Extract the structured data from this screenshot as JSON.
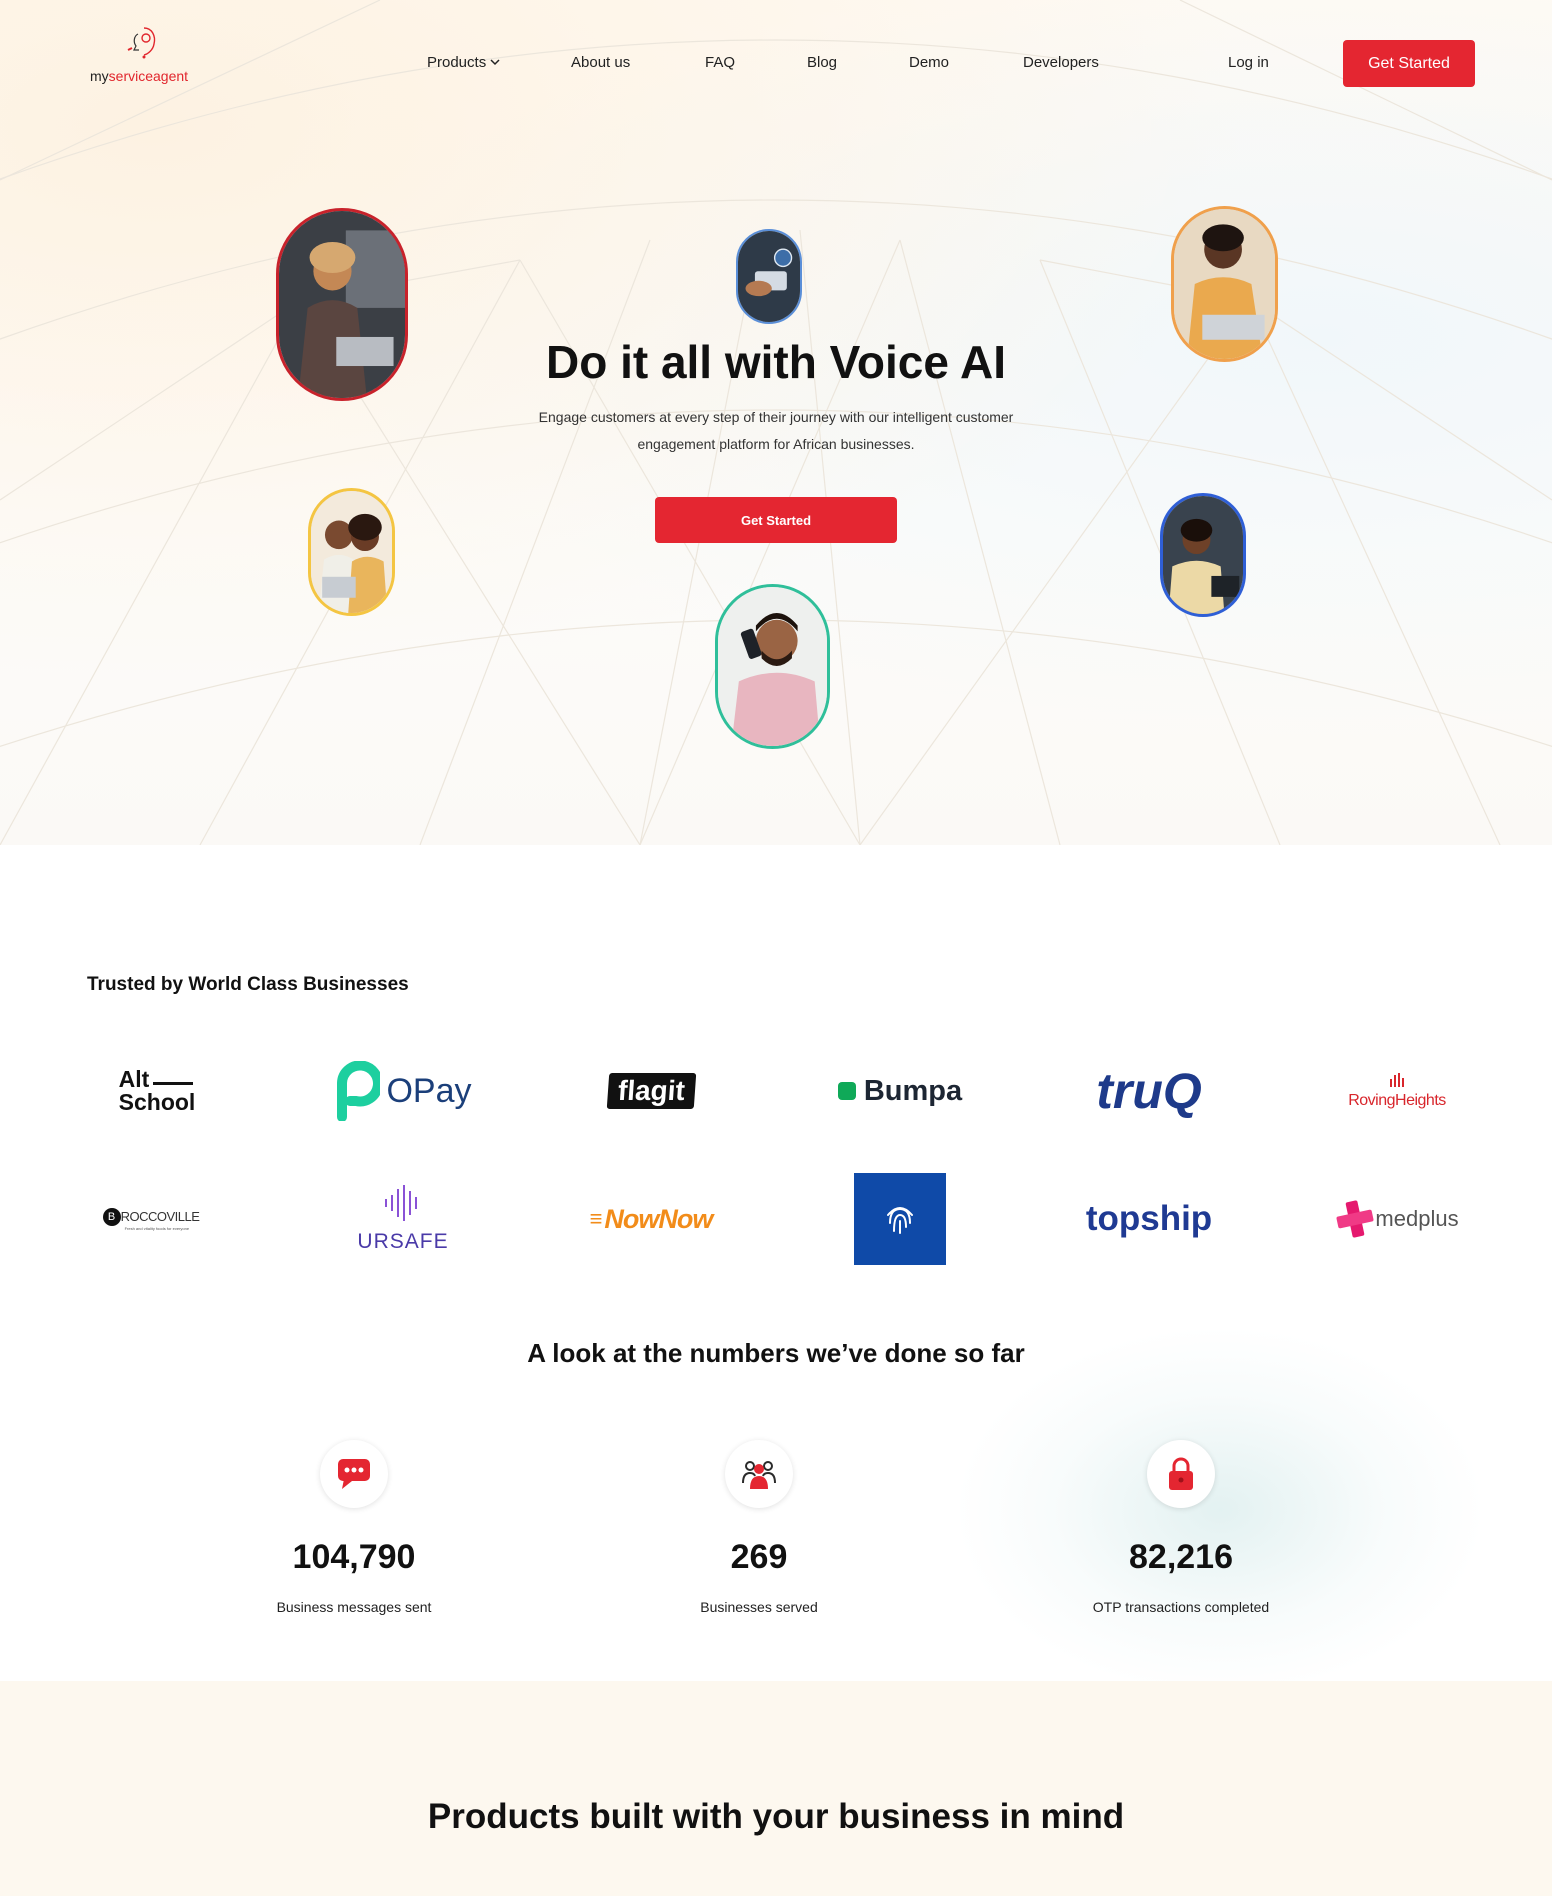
{
  "colors": {
    "brand_red": "#e42631",
    "hero_bg": "#fffaf3",
    "products_bg": "#fdf8ef"
  },
  "header": {
    "logo": {
      "prefix": "my",
      "suffix": "serviceagent",
      "icon": "headset-face-icon"
    },
    "nav": [
      {
        "label": "Products",
        "icon": "chevron-down-icon"
      },
      {
        "label": "About us"
      },
      {
        "label": "FAQ"
      },
      {
        "label": "Blog"
      },
      {
        "label": "Demo"
      },
      {
        "label": "Developers"
      },
      {
        "label": "Log in"
      }
    ],
    "cta_label": "Get Started"
  },
  "hero": {
    "title": "Do it all with Voice AI",
    "subtitle_line1": "Engage customers at every step of their journey with our intelligent customer",
    "subtitle_line2": "engagement platform for African businesses.",
    "cta_label": "Get Started",
    "avatars": [
      "red",
      "blue",
      "orange",
      "yellow",
      "green",
      "navy"
    ]
  },
  "trusted": {
    "heading": "Trusted by World Class Businesses",
    "logos": [
      {
        "name": "AltSchool",
        "line1": "Alt",
        "line2": "School"
      },
      {
        "name": "OPay",
        "text": "OPay"
      },
      {
        "name": "flagit",
        "text": "flagit"
      },
      {
        "name": "Bumpa",
        "text": "Bumpa"
      },
      {
        "name": "truQ",
        "text": "truQ"
      },
      {
        "name": "RovingHeights",
        "text": "RovingHeights"
      },
      {
        "name": "Broccoville",
        "text": "ROCCOVILLE",
        "tagline": "Fresh and vitality foods for everyone"
      },
      {
        "name": "URSAFE",
        "text": "URSAFE"
      },
      {
        "name": "NowNow",
        "text": "NowNow"
      },
      {
        "name": "fingerprint-logo",
        "icon": "fingerprint-icon"
      },
      {
        "name": "topship",
        "text": "topship"
      },
      {
        "name": "medplus",
        "text": "medplus"
      }
    ]
  },
  "numbers": {
    "heading": "A look at the numbers we’ve done so far",
    "stats": [
      {
        "value": "104,790",
        "label": "Business messages sent",
        "icon": "chat-bubble-icon"
      },
      {
        "value": "269",
        "label": "Businesses served",
        "icon": "people-group-icon"
      },
      {
        "value": "82,216",
        "label": "OTP transactions completed",
        "icon": "padlock-icon"
      }
    ]
  },
  "products": {
    "heading": "Products built with your business in mind"
  }
}
